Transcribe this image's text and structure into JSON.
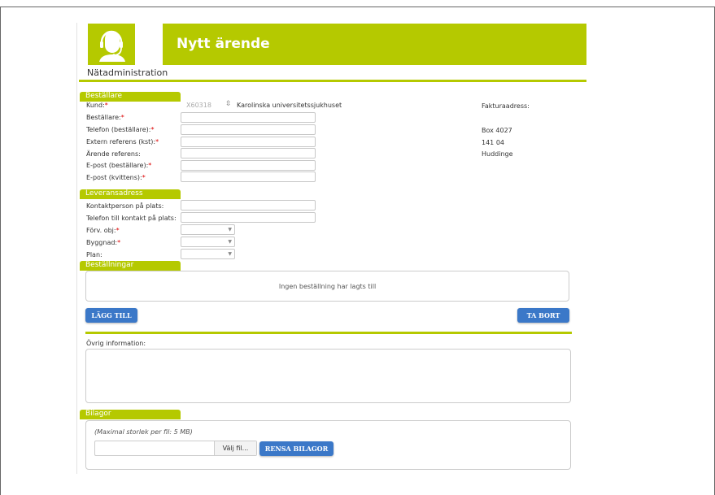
{
  "header": {
    "title": "Nytt ärende",
    "subtitle": "Nätadministration",
    "logo_icon": "headset-support-icon"
  },
  "bestallare": {
    "section_label": "Beställare",
    "fields": [
      {
        "label": "Kund:",
        "required": true
      },
      {
        "label": "Beställare:",
        "required": true
      },
      {
        "label": "Telefon (beställare):",
        "required": true
      },
      {
        "label": "Extern referens (kst):",
        "required": true
      },
      {
        "label": "Ärende referens:",
        "required": false
      },
      {
        "label": "E-post (beställare):",
        "required": true
      },
      {
        "label": "E-post (kvittens):",
        "required": true
      }
    ],
    "kund_code": "X60318",
    "kund_name": "Karolinska universitetssjukhuset"
  },
  "fakturaadress": {
    "label": "Fakturaadress:",
    "line1": "Box 4027",
    "line2": "141 04",
    "line3": "Huddinge"
  },
  "leveransadress": {
    "section_label": "Leveransadress",
    "fields": [
      {
        "label": "Kontaktperson på plats:",
        "required": false
      },
      {
        "label": "Telefon till kontakt på plats:",
        "required": false
      },
      {
        "label": "Förv. obj:",
        "required": true
      },
      {
        "label": "Byggnad:",
        "required": true
      },
      {
        "label": "Plan:",
        "required": false
      }
    ]
  },
  "bestallningar": {
    "section_label": "Beställningar",
    "empty_message": "Ingen beställning har lagts till",
    "add_label": "LÄGG TILL",
    "remove_label": "TA BORT"
  },
  "ovrig": {
    "label": "Övrig information:"
  },
  "bilagor": {
    "section_label": "Bilagor",
    "max_note": "(Maximal storlek per fil: 5 MB)",
    "choose_label": "Välj fil...",
    "clear_label": "RENSA BILAGOR"
  },
  "colors": {
    "accent": "#b5c900",
    "button": "#3b78c8",
    "required": "#dd0000"
  }
}
